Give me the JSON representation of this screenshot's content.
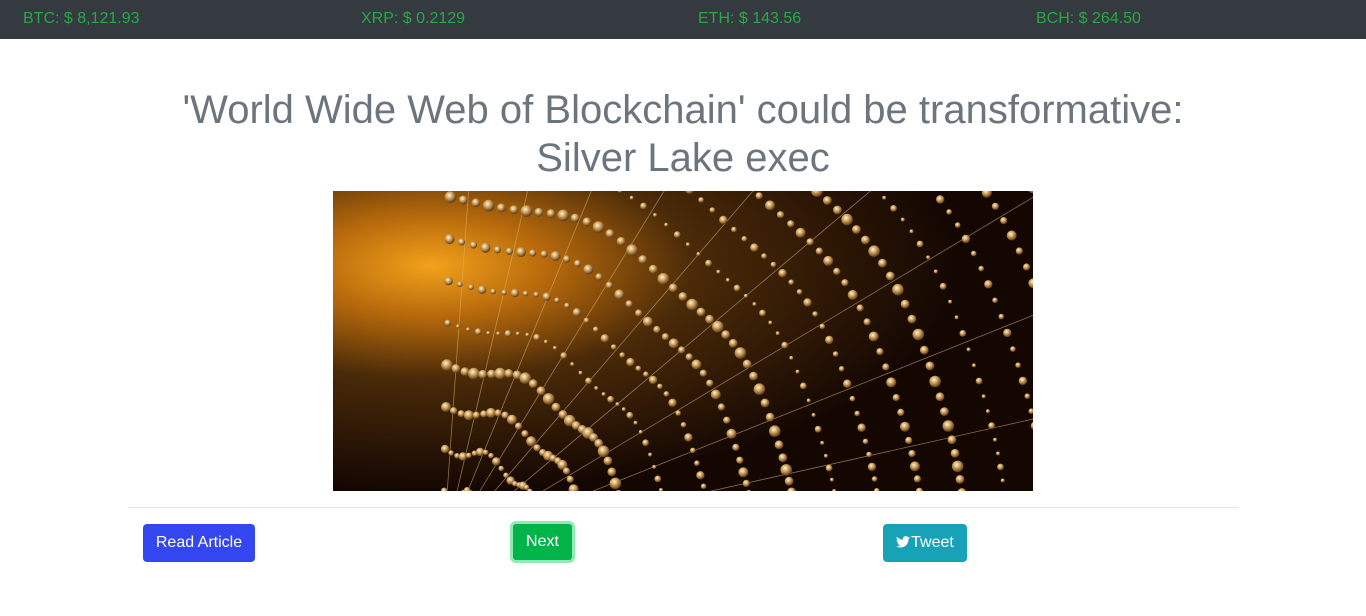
{
  "ticker": {
    "btc": "BTC: $ 8,121.93",
    "xrp": "XRP: $ 0.2129",
    "eth": "ETH: $ 143.56",
    "bch": "BCH: $ 264.50"
  },
  "article": {
    "title": "'World Wide Web of Blockchain' could be transformative: Silver Lake exec",
    "image_icon": "spider-web-dewdrops-photo"
  },
  "actions": {
    "read_label": "Read Article",
    "next_label": "Next",
    "tweet_label": "Tweet",
    "tweet_icon": "twitter-bird-icon"
  },
  "colors": {
    "ticker_bg": "#343a40",
    "ticker_text": "#28a745",
    "read_button": "#3346f0",
    "next_button": "#00b44a",
    "tweet_button": "#17a2b8",
    "title_text": "#6c757d"
  }
}
